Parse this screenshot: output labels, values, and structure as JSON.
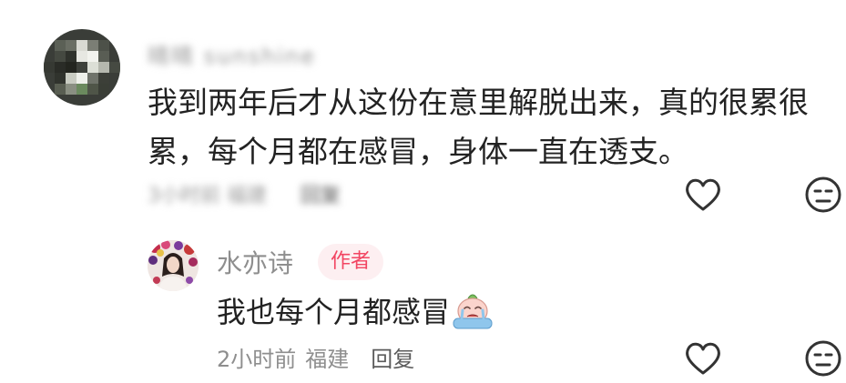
{
  "comment": {
    "username": "晴晴 sunshine",
    "text": "我到两年后才从这份在意里解脱出来，真的很累很累，每个月都在感冒，身体一直在透支。",
    "time": "3小时前",
    "location": "福建",
    "reply_label": "回复"
  },
  "reply": {
    "username": "水亦诗",
    "badge": "作者",
    "text": "我也每个月都感冒",
    "time": "2小时前",
    "location": "福建",
    "reply_label": "回复"
  },
  "icons": {
    "like": "heart-outline-icon",
    "dislike": "neutral-face-icon",
    "emoji": "crying-emoji-icon"
  },
  "colors": {
    "text": "#222222",
    "meta": "#8e8e8e",
    "badge_text": "#f24562",
    "badge_bg": "#fdeff1"
  }
}
